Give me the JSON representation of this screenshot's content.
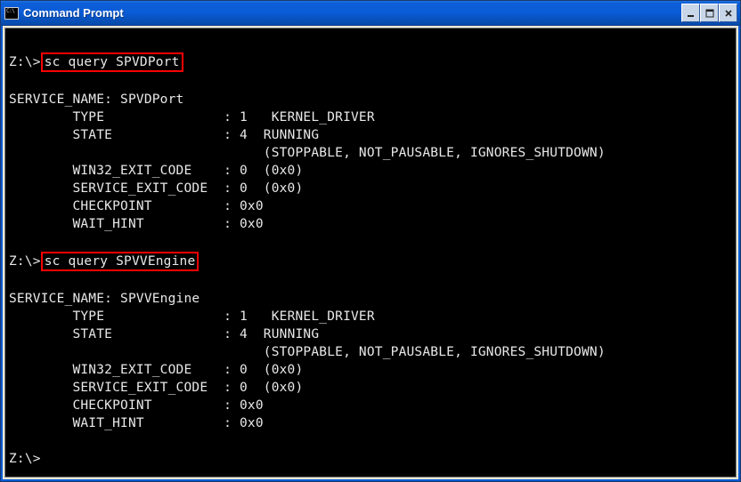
{
  "window": {
    "title": "Command Prompt"
  },
  "terminal": {
    "prompt_drive": "Z:\\>",
    "queries": [
      {
        "command": "sc query SPVDPort",
        "service_name": "SPVDPort",
        "fields": {
          "type_num": "1",
          "type_label": "KERNEL_DRIVER",
          "state_num": "4",
          "state_label": "RUNNING",
          "state_flags": "(STOPPABLE, NOT_PAUSABLE, IGNORES_SHUTDOWN)",
          "win32_exit_code": "0  (0x0)",
          "service_exit_code": "0  (0x0)",
          "checkpoint": "0x0",
          "wait_hint": "0x0"
        }
      },
      {
        "command": "sc query SPVVEngine",
        "service_name": "SPVVEngine",
        "fields": {
          "type_num": "1",
          "type_label": "KERNEL_DRIVER",
          "state_num": "4",
          "state_label": "RUNNING",
          "state_flags": "(STOPPABLE, NOT_PAUSABLE, IGNORES_SHUTDOWN)",
          "win32_exit_code": "0  (0x0)",
          "service_exit_code": "0  (0x0)",
          "checkpoint": "0x0",
          "wait_hint": "0x0"
        }
      }
    ]
  }
}
